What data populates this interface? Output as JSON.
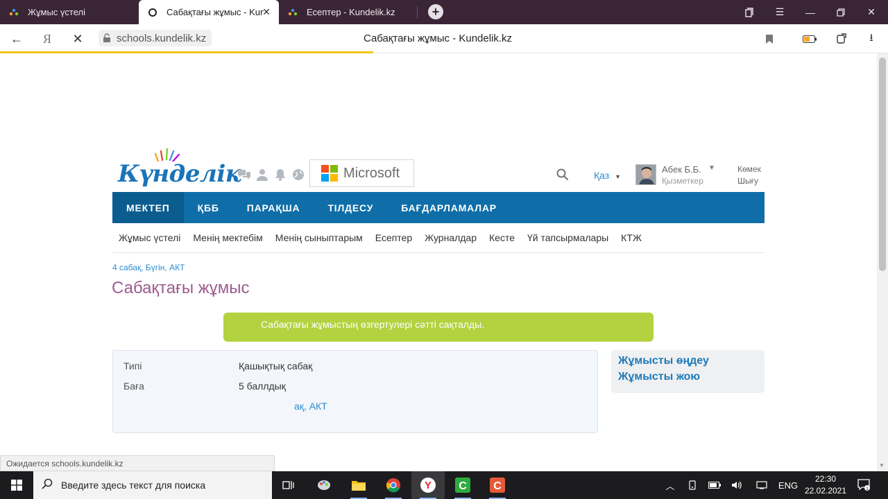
{
  "browser": {
    "tabs": [
      {
        "label": "Жұмыс үстелі",
        "active": false
      },
      {
        "label": "Сабақтағы жұмыс - Kundelik.kz",
        "active": true
      },
      {
        "label": "Есептер - Kundelik.kz",
        "active": false
      }
    ],
    "url": "schools.kundelik.kz",
    "page_title": "Сабақтағы жұмыс - Kundelik.kz",
    "status_text": "Ожидается schools.kundelik.kz",
    "load_progress": 0.42
  },
  "site": {
    "logo_text": "Күнделік",
    "partner_text": "Microsoft",
    "language": "Қаз",
    "user": {
      "name": "Абек Б.Б.",
      "role": "Қызметкер"
    },
    "help_label": "Көмек",
    "logout_label": "Шығу",
    "main_nav": [
      "МЕКТЕП",
      "ҚББ",
      "ПАРАҚША",
      "ТІЛДЕСУ",
      "БАҒДАРЛАМАЛАР"
    ],
    "sub_nav": [
      "Жұмыс үстелі",
      "Менің мектебім",
      "Менің сыныптарым",
      "Есептер",
      "Журналдар",
      "Кесте",
      "Үй тапсырмалары",
      "КТЖ"
    ],
    "colors": {
      "nav_blue": "#0f6ea8",
      "alert_green": "#b3d23f",
      "heading": "#9c5b8c",
      "link": "#2a8bd0"
    }
  },
  "content": {
    "breadcrumb": "4 сабақ, Бүгін, АКТ",
    "heading": "Сабақтағы жұмыс",
    "alert": "Сабақтағы жұмыстың өзгертулері сәтті сақталды.",
    "details": [
      {
        "label": "Типі",
        "value": "Қашықтық сабақ"
      },
      {
        "label": "Баға",
        "value": "5 баллдық"
      },
      {
        "label": "",
        "value": "ақ, АКТ"
      }
    ],
    "actions": [
      "Жұмысты өңдеу",
      "Жұмысты жою"
    ]
  },
  "taskbar": {
    "search_placeholder": "Введите здесь текст для поиска",
    "lang": "ENG",
    "time": "22:30",
    "date": "22.02.2021"
  }
}
